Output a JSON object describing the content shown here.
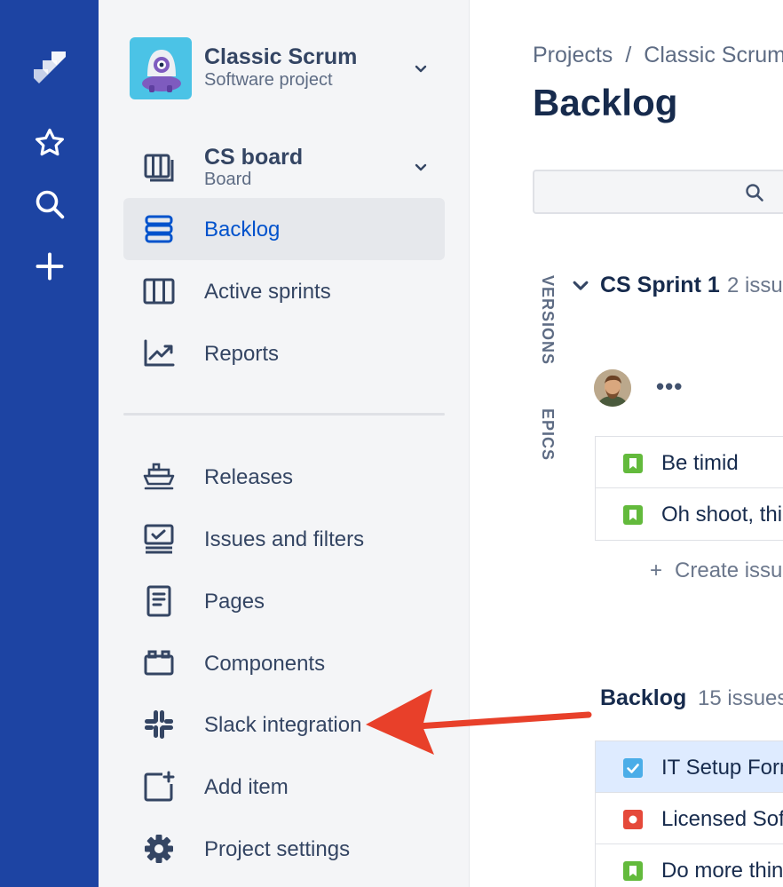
{
  "project": {
    "name": "Classic Scrum",
    "type": "Software project"
  },
  "board": {
    "title": "CS board",
    "subtitle": "Board"
  },
  "nav": {
    "backlog": "Backlog",
    "active_sprints": "Active sprints",
    "reports": "Reports",
    "releases": "Releases",
    "issues_filters": "Issues and filters",
    "pages": "Pages",
    "components": "Components",
    "slack": "Slack integration",
    "add_item": "Add item",
    "project_settings": "Project settings"
  },
  "breadcrumb": {
    "projects": "Projects",
    "separator": "/",
    "project": "Classic Scrum"
  },
  "page_title": "Backlog",
  "side_tabs": {
    "versions": "VERSIONS",
    "epics": "EPICS"
  },
  "sprint": {
    "name": "CS Sprint 1",
    "count": "2 issu",
    "more": "•••",
    "issues": [
      {
        "title": "Be timid",
        "type": "story"
      },
      {
        "title": "Oh shoot, thi",
        "type": "story"
      }
    ],
    "create_issue": "Create issu"
  },
  "backlog": {
    "title": "Backlog",
    "count": "15 issues",
    "issues": [
      {
        "title": "IT Setup Form",
        "type": "task",
        "selected": true
      },
      {
        "title": "Licensed Sof",
        "type": "bug"
      },
      {
        "title": "Do more thin",
        "type": "story"
      }
    ]
  },
  "colors": {
    "rail": "#1D44A3",
    "sidebar": "#F4F5F7",
    "active_text": "#0052CC",
    "story": "#63BA3C",
    "task": "#4BADE8",
    "bug": "#E5493A",
    "annotation_arrow": "#E8402A"
  },
  "icons": {
    "rail": [
      "jira-logo-icon",
      "star-icon",
      "search-icon",
      "plus-icon"
    ],
    "nav": [
      "board-icon",
      "backlog-icon",
      "active-sprints-icon",
      "reports-icon",
      "releases-icon",
      "issues-filters-icon",
      "pages-icon",
      "components-icon",
      "slack-icon",
      "add-item-icon",
      "settings-icon"
    ]
  }
}
